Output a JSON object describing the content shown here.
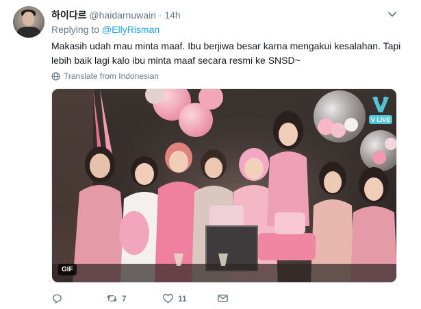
{
  "tweet": {
    "display_name": "하이다르",
    "handle": "@haidarnuwairi",
    "separator": "·",
    "time": "14h",
    "replying_prefix": "Replying to",
    "replying_to": "@EllyRisman",
    "text": "Makasih udah mau minta maaf. Ibu berjiwa besar karna mengakui kesalahan. Tapi lebih baik lagi kalo ibu minta maaf secara resmi ke SNSD~",
    "translate_label": "Translate from Indonesian",
    "media": {
      "badge": "GIF",
      "watermark": "V LIVE"
    },
    "actions": {
      "reply_count": "",
      "retweet_count": "7",
      "like_count": "11"
    }
  },
  "colors": {
    "link": "#1da1f2",
    "muted": "#657786",
    "text": "#14171a",
    "vlive": "#54c5d8"
  },
  "icons": [
    "caret-down-icon",
    "globe-icon",
    "reply-icon",
    "retweet-icon",
    "heart-icon",
    "message-icon"
  ]
}
